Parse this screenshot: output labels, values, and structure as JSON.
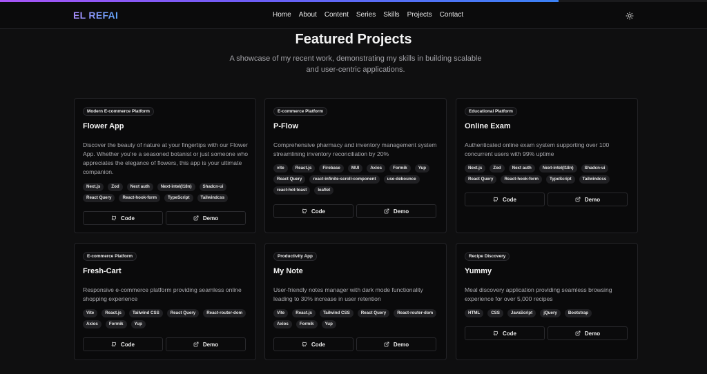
{
  "brand": {
    "logo": "EL REFAI",
    "progress_fraction": 0.79
  },
  "nav": {
    "items": [
      "Home",
      "About",
      "Content",
      "Series",
      "Skills",
      "Projects",
      "Contact"
    ],
    "theme_icon": "sun-icon"
  },
  "section": {
    "title": "Featured Projects",
    "subtitle": "A showcase of my recent work, demonstrating my skills in building scalable and user-centric applications."
  },
  "buttons": {
    "code_label": "Code",
    "demo_label": "Demo",
    "code_icon": "github-icon",
    "demo_icon": "external-link-icon"
  },
  "projects": [
    {
      "category": "Modern E-commerce Platform",
      "title": "Flower App",
      "description": "Discover the beauty of nature at your fingertips with our Flower App. Whether you're a seasoned botanist or just someone who appreciates the elegance of flowers, this app is your ultimate companion.",
      "tags": [
        "Next.js",
        "Zod",
        "Next auth",
        "Next-intel(I18n)",
        "Shadcn-ui",
        "React Query",
        "React-hook-form",
        "TypeScript",
        "Tailwindcss"
      ]
    },
    {
      "category": "E-commerce Platform",
      "title": "P-Flow",
      "description": "Comprehensive pharmacy and inventory management system streamlining inventory reconciliation by 20%",
      "tags": [
        "vite",
        "React.js",
        "Firebase",
        "MUI",
        "Axios",
        "Formik",
        "Yup",
        "React Query",
        "react-infinite-scroll-component",
        "use-debounce",
        "react-hot-toast",
        "leaflet"
      ]
    },
    {
      "category": "Educational Platform",
      "title": "Online Exam",
      "description": "Authenticated online exam system supporting over 100 concurrent users with 99% uptime",
      "tags": [
        "Next.js",
        "Zod",
        "Next auth",
        "Next-intel(I18n)",
        "Shadcn-ui",
        "React Query",
        "React-hook-form",
        "TypeScript",
        "Tailwindcss"
      ]
    },
    {
      "category": "E-commerce Platform",
      "title": "Fresh-Cart",
      "description": "Responsive e-commerce platform providing seamless online shopping experience",
      "tags": [
        "Vite",
        "React.js",
        "Tailwind CSS",
        "React Query",
        "React-router-dom",
        "Axios",
        "Formik",
        "Yup"
      ]
    },
    {
      "category": "Productivity App",
      "title": "My Note",
      "description": "User-friendly notes manager with dark mode functionality leading to 30% increase in user retention",
      "tags": [
        "Vite",
        "React.js",
        "Tailwind CSS",
        "React Query",
        "React-router-dom",
        "Axios",
        "Formik",
        "Yup"
      ]
    },
    {
      "category": "Recipe Discovery",
      "title": "Yummy",
      "description": "Meal discovery application providing seamless browsing experience for over 5,000 recipes",
      "tags": [
        "HTML",
        "CSS",
        "JavaScript",
        "jQuery",
        "Bootstrap"
      ]
    }
  ]
}
